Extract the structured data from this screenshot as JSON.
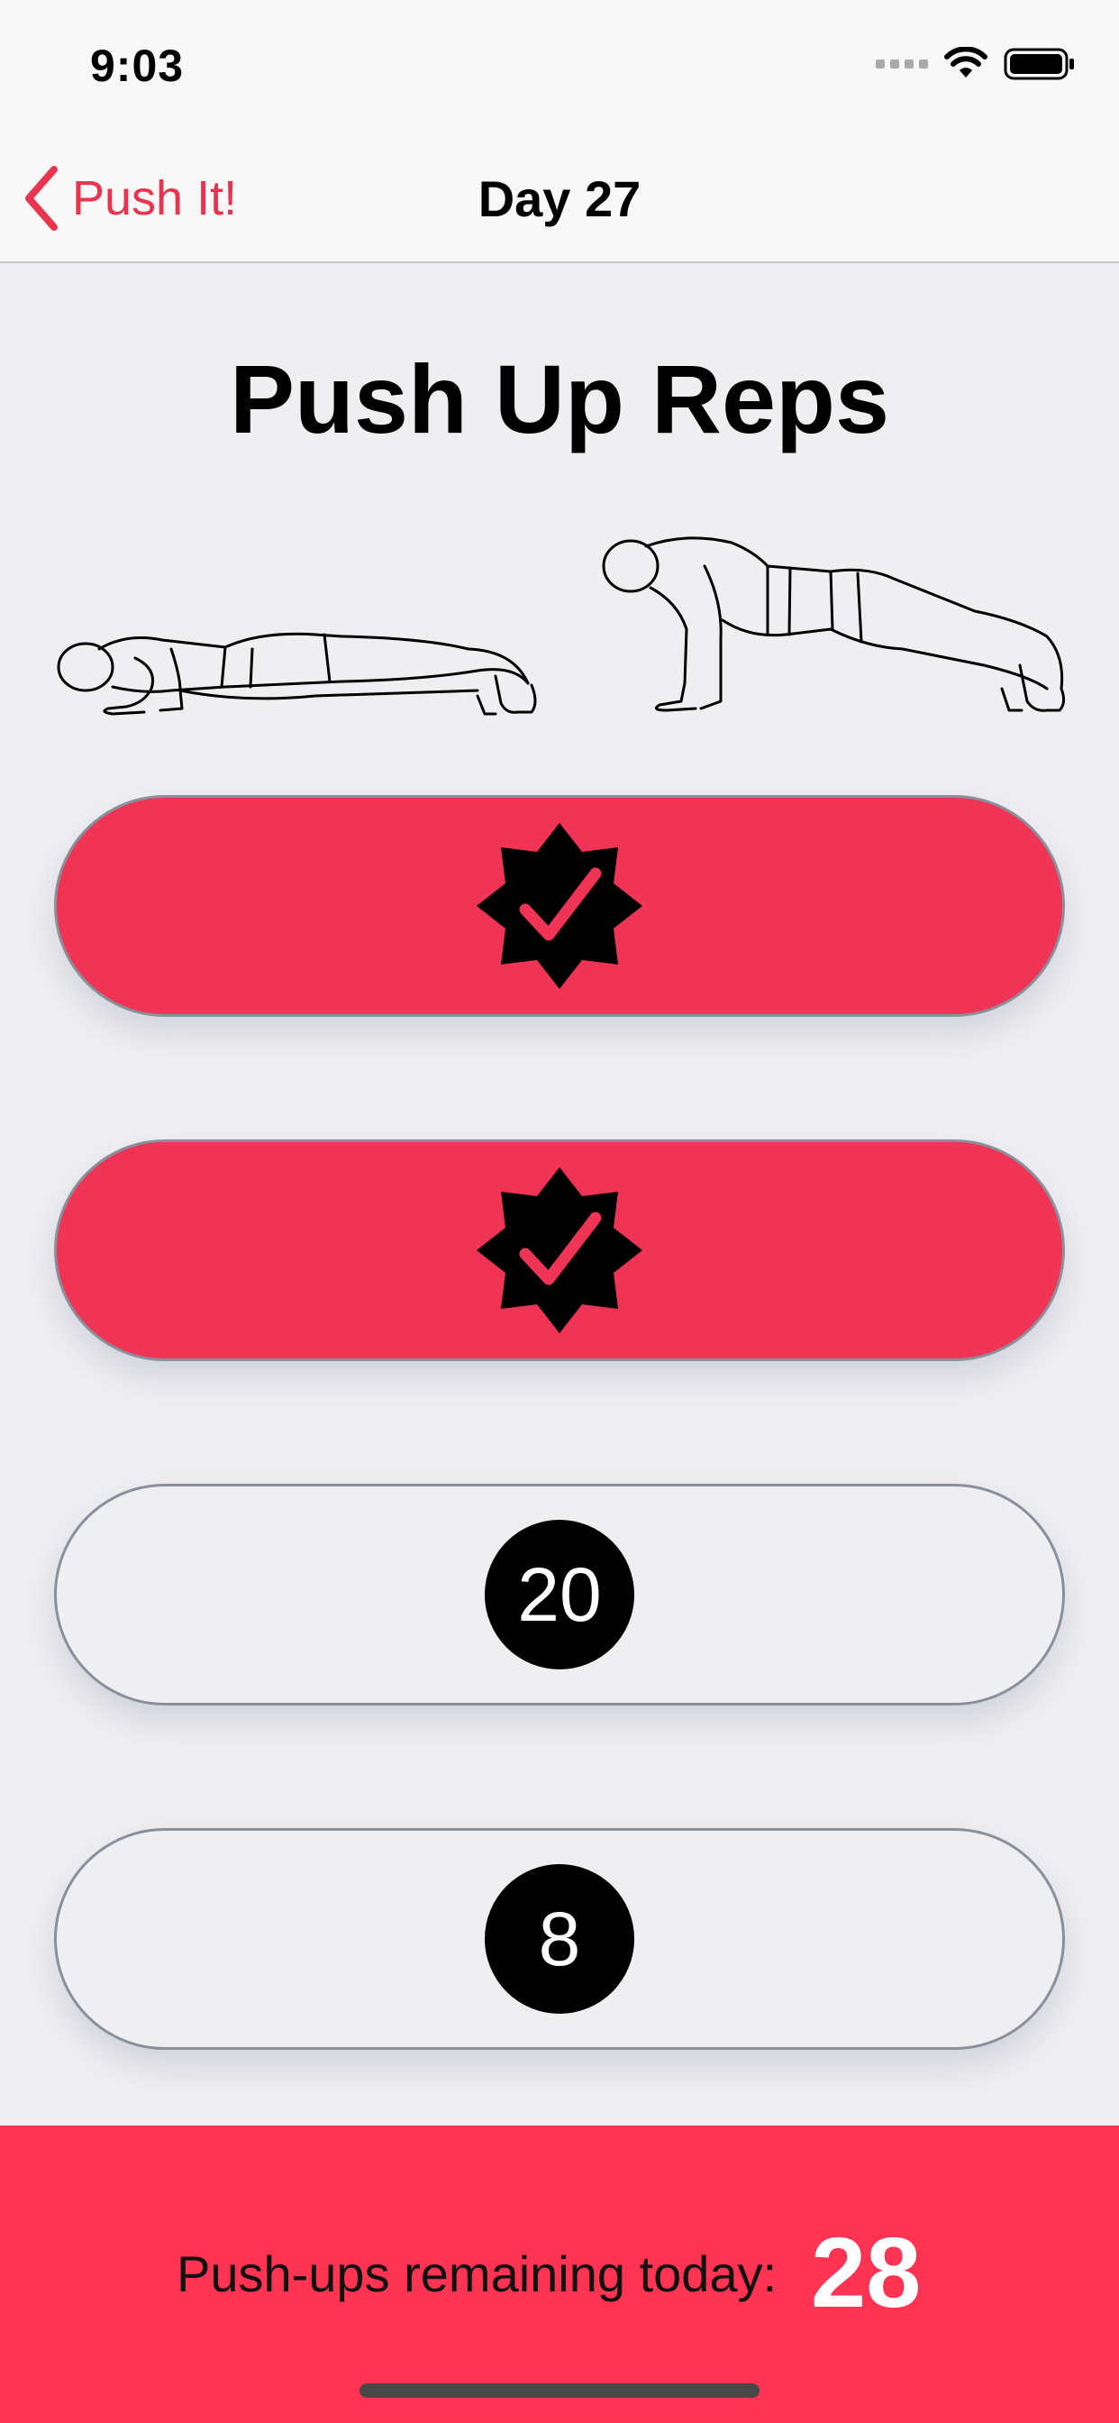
{
  "status_bar": {
    "time": "9:03"
  },
  "nav": {
    "back_label": "Push It!",
    "title": "Day 27"
  },
  "main": {
    "title": "Push Up Reps",
    "reps": [
      {
        "state": "done",
        "icon": "checkmark-seal-icon"
      },
      {
        "state": "done",
        "icon": "checkmark-seal-icon"
      },
      {
        "state": "todo",
        "count": "20"
      },
      {
        "state": "todo",
        "count": "8"
      }
    ]
  },
  "footer": {
    "remaining_label": "Push-ups remaining today:",
    "remaining_value": "28"
  },
  "colors": {
    "accent": "#e8344f",
    "pill_done": "#ef3455",
    "footer": "#ff3352",
    "background": "#efeef0"
  }
}
